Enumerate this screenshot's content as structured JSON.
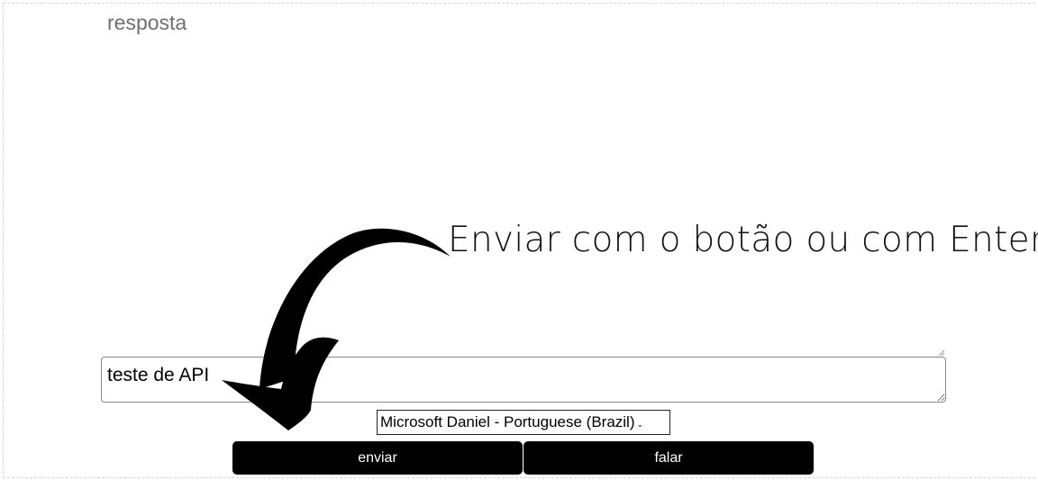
{
  "response": {
    "label": "resposta"
  },
  "annotation": {
    "text": "Enviar com o botão ou com Enter"
  },
  "input": {
    "value": "teste de API"
  },
  "voice_select": {
    "selected": "Microsoft Daniel - Portuguese (Brazil)"
  },
  "buttons": {
    "send_label": "enviar",
    "speak_label": "falar"
  },
  "colors": {
    "button_bg": "#000000",
    "button_text": "#ffffff",
    "response_text": "#6f6f6f"
  },
  "icons": {
    "annotation_arrow": "curved-arrow-icon",
    "select_chevron": "chevron-down-icon"
  }
}
